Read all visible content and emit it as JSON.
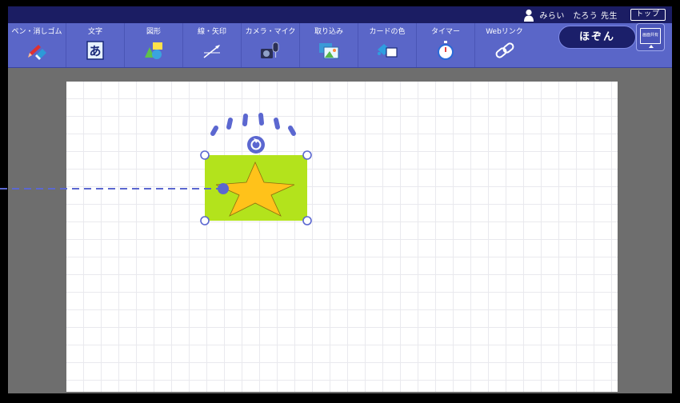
{
  "header": {
    "user_name": "みらい　たろう 先生",
    "top_label": "トップ"
  },
  "toolbar": {
    "tools": [
      {
        "id": "pen",
        "label": "ペン・消しゴム",
        "icon": "pen-eraser-icon"
      },
      {
        "id": "text",
        "label": "文字",
        "icon": "text-a-icon"
      },
      {
        "id": "shape",
        "label": "図形",
        "icon": "shapes-icon"
      },
      {
        "id": "line",
        "label": "線・矢印",
        "icon": "line-arrow-icon"
      },
      {
        "id": "camera",
        "label": "カメラ・マイク",
        "icon": "camera-mic-icon"
      },
      {
        "id": "import",
        "label": "取り込み",
        "icon": "import-image-icon"
      },
      {
        "id": "color",
        "label": "カードの色",
        "icon": "card-color-icon"
      },
      {
        "id": "timer",
        "label": "タイマー",
        "icon": "timer-icon"
      },
      {
        "id": "web",
        "label": "Webリンク",
        "icon": "web-link-icon"
      }
    ],
    "save_label": "ほぞん",
    "share_label": "画面共有"
  },
  "colors": {
    "topbar": "#1b1d63",
    "toolbar": "#5a66c8",
    "canvas_bg": "#6e6e6e",
    "selected_rect": "#b3e31c",
    "star": "#ffc21a",
    "accent": "#5b67d0"
  }
}
